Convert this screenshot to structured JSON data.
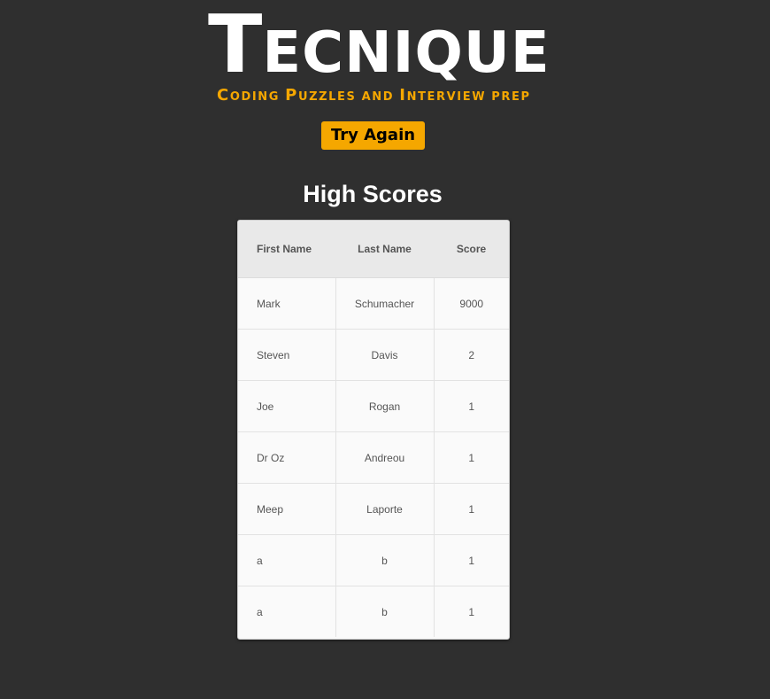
{
  "header": {
    "logo_first": "T",
    "logo_rest": "ECNIQUE",
    "tagline_parts": [
      {
        "big": "C",
        "small": "ODING "
      },
      {
        "big": "P",
        "small": "UZZLES AND "
      },
      {
        "big": "I",
        "small": "NTERVIEW PREP"
      }
    ]
  },
  "actions": {
    "try_again_label": "Try Again"
  },
  "scores": {
    "title": "High Scores",
    "columns": [
      "First Name",
      "Last Name",
      "Score"
    ],
    "rows": [
      {
        "first": "Mark",
        "last": "Schumacher",
        "score": "9000"
      },
      {
        "first": "Steven",
        "last": "Davis",
        "score": "2"
      },
      {
        "first": "Joe",
        "last": "Rogan",
        "score": "1"
      },
      {
        "first": "Dr Oz",
        "last": "Andreou",
        "score": "1"
      },
      {
        "first": "Meep",
        "last": "Laporte",
        "score": "1"
      },
      {
        "first": "a",
        "last": "b",
        "score": "1"
      },
      {
        "first": "a",
        "last": "b",
        "score": "1"
      }
    ]
  },
  "colors": {
    "background": "#2f2f2f",
    "accent": "#f5a700",
    "table_background": "#fafafa",
    "table_header": "#e9e9e9"
  }
}
